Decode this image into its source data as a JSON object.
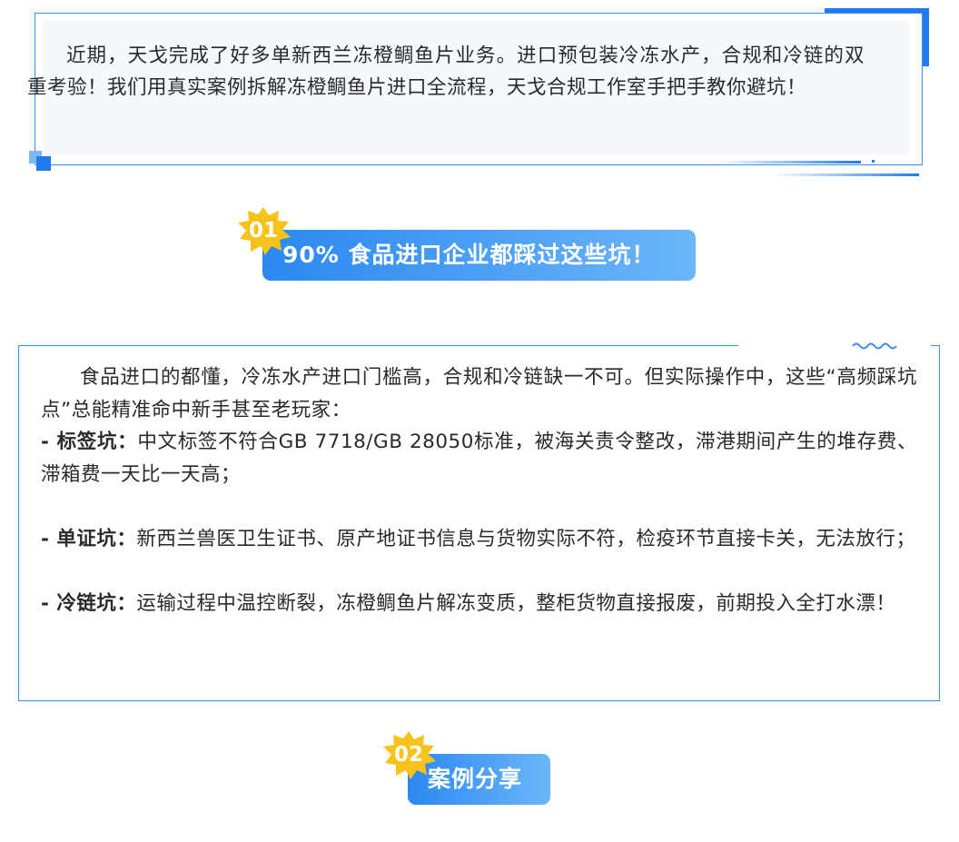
{
  "intro": {
    "text": "近期，天戈完成了好多单新西兰冻橙鲷鱼片业务。进口预包装冷冻水产，合规和冷链的双重考验！我们用真实案例拆解冻橙鲷鱼片进口全流程，天戈合规工作室手把手教你避坑！"
  },
  "section1": {
    "number": "01",
    "title": "90% 食品进口企业都踩过这些坑！"
  },
  "content": {
    "lead": "食品进口的都懂，冷冻水产进口门槛高，合规和冷链缺一不可。但实际操作中，这些“高频踩坑点”总能精准命中新手甚至老玩家：",
    "items": [
      {
        "label": "- 标签坑：",
        "text": "中文标签不符合GB 7718/GB 28050标准，被海关责令整改，滞港期间产生的堆存费、滞箱费一天比一天高；"
      },
      {
        "label": "- 单证坑：",
        "text": "新西兰兽医卫生证书、原产地证书信息与货物实际不符，检疫环节直接卡关，无法放行；"
      },
      {
        "label": "- 冷链坑：",
        "text": "运输过程中温控断裂，冻橙鲷鱼片解冻变质，整柜货物直接报废，前期投入全打水漂！"
      }
    ]
  },
  "section2": {
    "number": "02",
    "title": "案例分享"
  },
  "colors": {
    "accent": "#1f7bef",
    "border": "#3d8fe9",
    "badge_start": "#2c88f0",
    "badge_end": "#6bb6fa",
    "star": "#f7c21a"
  }
}
